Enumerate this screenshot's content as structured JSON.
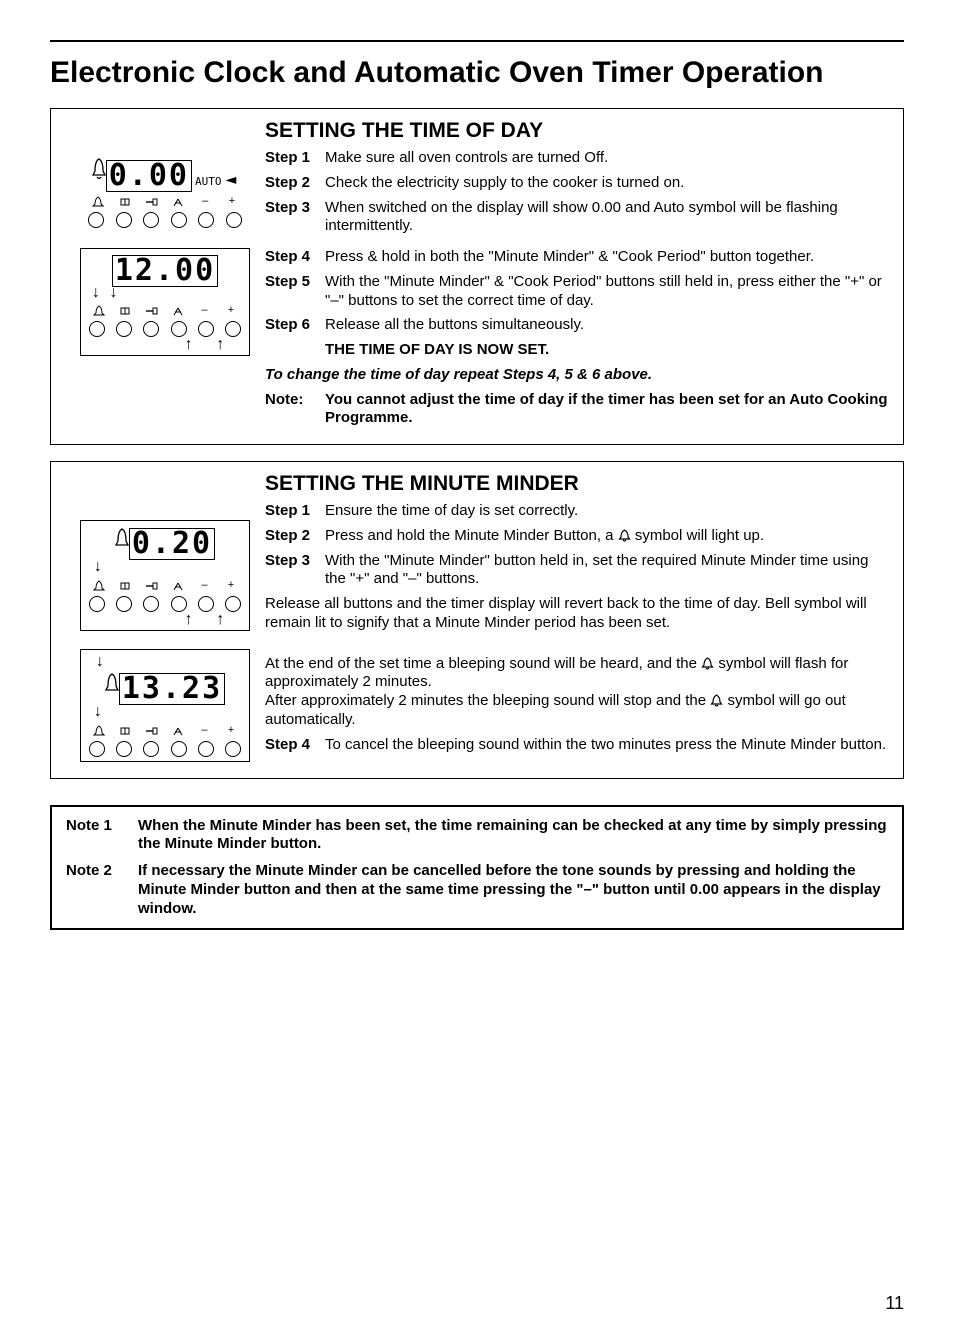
{
  "page": {
    "title": "Electronic Clock and Automatic Oven Timer Operation",
    "page_number": "11"
  },
  "section_time": {
    "heading": "SETTING THE TIME OF DAY",
    "display_top": "0.00",
    "display_top_auto": "AUTO",
    "display_bottom": "12.00",
    "steps": {
      "s1_label": "Step 1",
      "s1_text": "Make sure all oven controls are turned Off.",
      "s2_label": "Step 2",
      "s2_text": "Check the electricity supply to the cooker is turned on.",
      "s3_label": "Step 3",
      "s3_text": "When switched on the display will show 0.00 and Auto symbol will be flashing intermittently.",
      "s4_label": "Step 4",
      "s4_text": "Press & hold in both the \"Minute Minder\" & \"Cook Period\" button together.",
      "s5_label": "Step 5",
      "s5_text": "With the \"Minute Minder\" & \"Cook Period\" buttons still held in, press either the \"+\" or \"–\" buttons to set the correct time of day.",
      "s6_label": "Step 6",
      "s6_text": "Release all the buttons simultaneously."
    },
    "now_set": "THE TIME OF DAY IS NOW SET.",
    "repeat": "To change the time of day repeat Steps 4, 5 & 6 above.",
    "note_label": "Note:",
    "note_text": "You cannot adjust the time of day if the timer has been set for an Auto Cooking Programme."
  },
  "section_mm": {
    "heading": "SETTING THE MINUTE MINDER",
    "display_top": "0.20",
    "display_bottom": "13.23",
    "steps": {
      "s1_label": "Step 1",
      "s1_text": "Ensure the time of day is set correctly.",
      "s2_label": "Step 2",
      "s2_text_a": "Press and hold the Minute Minder Button, a ",
      "s2_text_b": "symbol will light up.",
      "s3_label": "Step 3",
      "s3_text": "With the \"Minute Minder\" button held in, set the required Minute Minder time using the \"+\" and \"–\" buttons.",
      "release": "Release all buttons and the timer display will revert back to the time of day. Bell symbol will remain lit to signify that a Minute Minder period has been set.",
      "end_a": "At the end of the set time a bleeping sound will be heard, and the ",
      "end_b": "symbol will flash for approximately 2 minutes.",
      "end_c": "After approximately 2 minutes the bleeping sound will stop and the ",
      "end_d": "symbol will go out automatically.",
      "s4_label": "Step 4",
      "s4_text": "To cancel the bleeping sound within the two minutes press the Minute Minder button."
    }
  },
  "footer_notes": {
    "n1_label": "Note 1",
    "n1_text": "When the Minute Minder has been set, the time remaining can be checked at any time by simply pressing the Minute Minder button.",
    "n2_label": "Note 2",
    "n2_text": "If necessary the Minute Minder can be cancelled before the tone sounds by pressing and holding the Minute Minder button and then at the same time pressing the \"–\" button until 0.00 appears in the display window."
  },
  "timer_glyphs": {
    "bell": "🔔",
    "cook": "⧗",
    "stop": "━┫",
    "minus": "–",
    "plus": "+"
  }
}
